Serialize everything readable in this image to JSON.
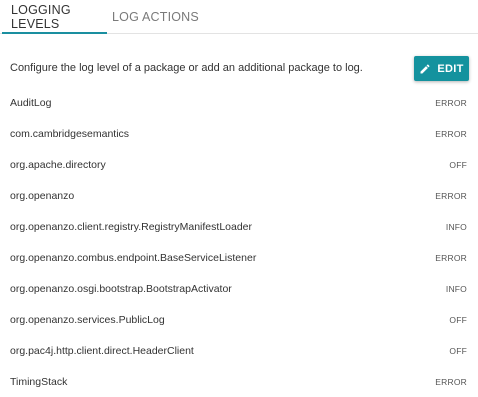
{
  "tabs": [
    {
      "label": "LOGGING LEVELS",
      "active": true
    },
    {
      "label": "LOG ACTIONS",
      "active": false
    }
  ],
  "intro_text": "Configure the log level of a package or add an additional package to log.",
  "edit_button": {
    "label": "EDIT",
    "icon": "pencil-icon"
  },
  "colors": {
    "accent": "#14929e",
    "tab_underline": "#1a8fa0"
  },
  "log_levels": [
    {
      "package": "AuditLog",
      "level": "ERROR"
    },
    {
      "package": "com.cambridgesemantics",
      "level": "ERROR"
    },
    {
      "package": "org.apache.directory",
      "level": "OFF"
    },
    {
      "package": "org.openanzo",
      "level": "ERROR"
    },
    {
      "package": "org.openanzo.client.registry.RegistryManifestLoader",
      "level": "INFO"
    },
    {
      "package": "org.openanzo.combus.endpoint.BaseServiceListener",
      "level": "ERROR"
    },
    {
      "package": "org.openanzo.osgi.bootstrap.BootstrapActivator",
      "level": "INFO"
    },
    {
      "package": "org.openanzo.services.PublicLog",
      "level": "OFF"
    },
    {
      "package": "org.pac4j.http.client.direct.HeaderClient",
      "level": "OFF"
    },
    {
      "package": "TimingStack",
      "level": "ERROR"
    }
  ]
}
